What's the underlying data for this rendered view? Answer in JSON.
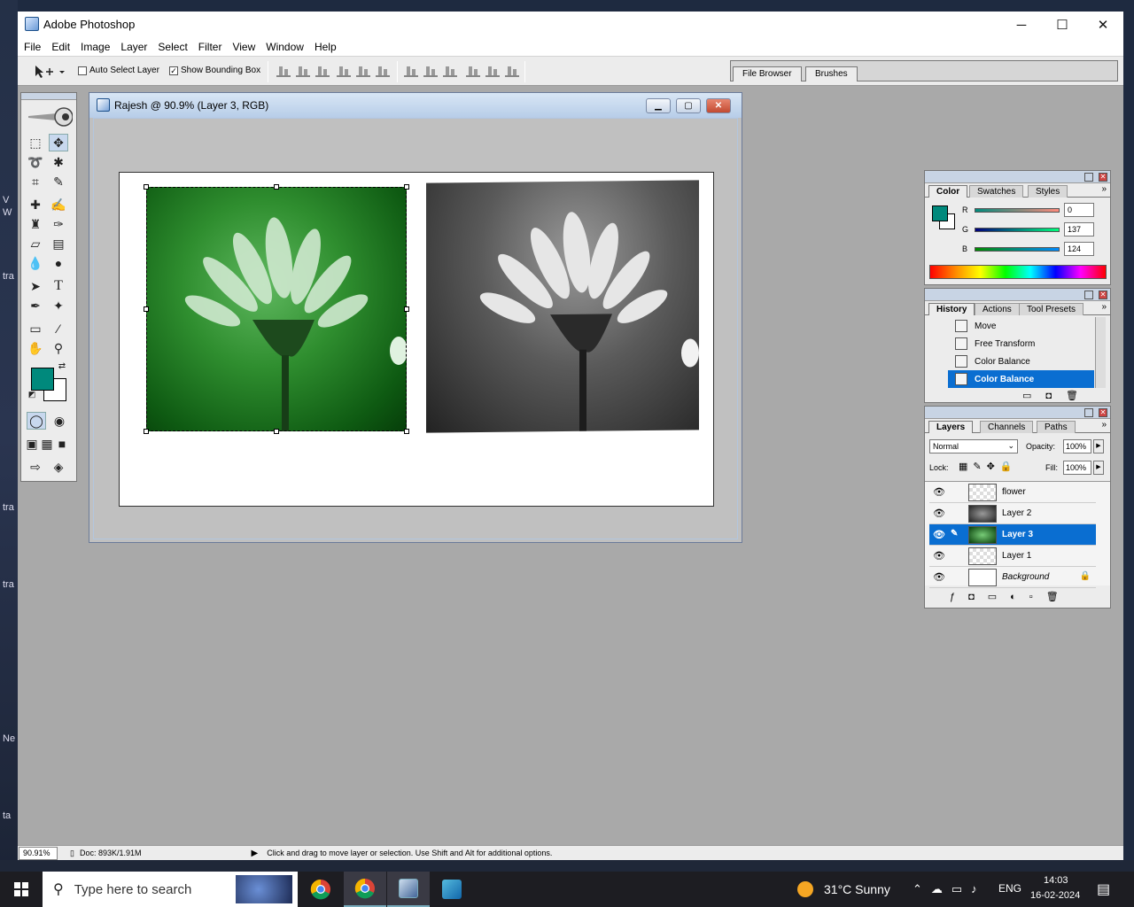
{
  "desktop": {
    "side_labels": [
      "V",
      "W",
      "tra",
      "tra",
      "tra",
      "Ne",
      "ta"
    ]
  },
  "window": {
    "title": "Adobe Photoshop",
    "minimize": "─",
    "maximize": "☐",
    "close": "✕"
  },
  "menu": [
    "File",
    "Edit",
    "Image",
    "Layer",
    "Select",
    "Filter",
    "View",
    "Window",
    "Help"
  ],
  "options_bar": {
    "auto_select_label": "Auto Select Layer",
    "auto_select_checked": false,
    "bounding_box_label": "Show Bounding Box",
    "bounding_box_checked": true,
    "check_mark": "✓"
  },
  "palette_well": {
    "tabs": [
      "File Browser",
      "Brushes"
    ]
  },
  "document": {
    "title": "Rajesh @ 90.9% (Layer 3, RGB)"
  },
  "color_panel": {
    "tabs": [
      "Color",
      "Swatches",
      "Styles"
    ],
    "channels": [
      {
        "label": "R",
        "value": "0"
      },
      {
        "label": "G",
        "value": "137"
      },
      {
        "label": "B",
        "value": "124"
      }
    ],
    "foreground": "#00897c"
  },
  "history_panel": {
    "tabs": [
      "History",
      "Actions",
      "Tool Presets"
    ],
    "items": [
      "Move",
      "Free Transform",
      "Color Balance",
      "Color Balance"
    ],
    "selected_index": 3
  },
  "layers_panel": {
    "tabs": [
      "Layers",
      "Channels",
      "Paths"
    ],
    "blend_mode": "Normal",
    "opacity_label": "Opacity:",
    "opacity": "100%",
    "lock_label": "Lock:",
    "fill_label": "Fill:",
    "fill": "100%",
    "layers": [
      "flower",
      "Layer 2",
      "Layer 3",
      "Layer 1",
      "Background"
    ],
    "selected_index": 2
  },
  "status": {
    "zoom": "90.91%",
    "doc": "Doc: 893K/1.91M",
    "hint": "Click and drag to move layer or selection.  Use Shift and Alt for additional options."
  },
  "taskbar": {
    "search_placeholder": "Type here to search",
    "weather": "31°C  Sunny",
    "language": "ENG",
    "time": "14:03",
    "date": "16-02-2024"
  }
}
